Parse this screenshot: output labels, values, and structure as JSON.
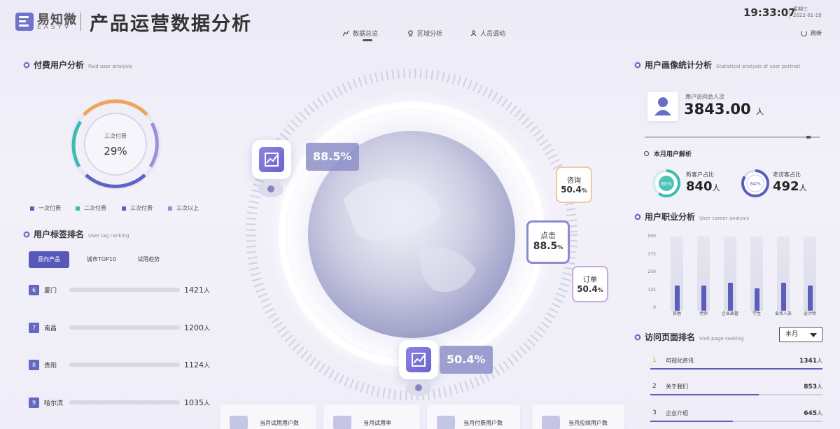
{
  "brand": {
    "cn": "易知微",
    "en": "EASYV"
  },
  "title": "产品运营数据分析",
  "time": {
    "clock": "19:33:07",
    "weekday": "星期三",
    "date": "2022-01-19"
  },
  "nav": [
    {
      "label": "数据总览",
      "icon": "chart-line-icon"
    },
    {
      "label": "区域分析",
      "icon": "location-icon"
    },
    {
      "label": "人员调动",
      "icon": "people-icon"
    }
  ],
  "refresh_label": "刷新",
  "paid_users": {
    "title": "付费用户分析",
    "subtitle": "Paid user analysis",
    "center_label": "三次付费",
    "center_value": "29%",
    "legend": [
      {
        "label": "一次付费",
        "color": "#5b5fba"
      },
      {
        "label": "二次付费",
        "color": "#44b8b0"
      },
      {
        "label": "三次付费",
        "color": "#5d63c9"
      },
      {
        "label": "三次以上",
        "color": "#9a8fdb"
      }
    ]
  },
  "tag_rank": {
    "title": "用户标签排名",
    "subtitle": "User tag ranking",
    "tabs": [
      "意向产品",
      "城市TOP10",
      "试用趋势"
    ],
    "rows": [
      {
        "num": "6",
        "city": "厦门",
        "value": "1421",
        "unit": "人",
        "ratio": 0.42
      },
      {
        "num": "7",
        "city": "南昌",
        "value": "1200",
        "unit": "人",
        "ratio": 0.35
      },
      {
        "num": "8",
        "city": "贵阳",
        "value": "1124",
        "unit": "人",
        "ratio": 0.33
      },
      {
        "num": "9",
        "city": "哈尔滨",
        "value": "1035",
        "unit": "人",
        "ratio": 0.3
      }
    ]
  },
  "center": {
    "pct_top": "88.5%",
    "pct_bottom": "50.4%",
    "bubbles": [
      {
        "label": "咨询",
        "value": "50.4",
        "unit": "%",
        "color": "#f0c8a0"
      },
      {
        "label": "点击",
        "value": "88.5",
        "unit": "%",
        "color": "#8a8cd0"
      },
      {
        "label": "订单",
        "value": "50.4",
        "unit": "%",
        "color": "#c8a8e0"
      }
    ],
    "bottom_cards": [
      "当月试用用户数",
      "当月试用率",
      "当月付费用户数",
      "当月应续用户数"
    ]
  },
  "portrait": {
    "title": "用户画像统计分析",
    "subtitle": "Statistical analysis of user portrait",
    "visit_label": "用户访问总人次",
    "visit_value": "3843.00",
    "visit_unit": "人",
    "month_title": "本月用户解析",
    "new": {
      "label": "新客户占比",
      "pct": "60%",
      "value": "840",
      "unit": "人",
      "color": "#3bbcb0"
    },
    "old": {
      "label": "老访客占比",
      "pct": "84%",
      "value": "492",
      "unit": "人",
      "color": "#5b5fba"
    }
  },
  "career": {
    "title": "用户职业分析",
    "subtitle": "User career analysis",
    "chart_data": {
      "type": "bar",
      "categories": [
        "其他",
        "老师",
        "企业高管",
        "学生",
        "业务人员",
        "设计师"
      ],
      "values": [
        175,
        175,
        195,
        155,
        195,
        175
      ],
      "yticks": [
        "500",
        "375",
        "250",
        "125",
        "0"
      ],
      "ylim": [
        0,
        500
      ]
    }
  },
  "visits": {
    "title": "访问页面排名",
    "subtitle": "Visit page ranking",
    "select": "本月",
    "rows": [
      {
        "idx": "1",
        "name": "可视化资讯",
        "value": "1341",
        "unit": "人",
        "ratio": 1.0
      },
      {
        "idx": "2",
        "name": "关于我们",
        "value": "853",
        "unit": "人",
        "ratio": 0.63
      },
      {
        "idx": "3",
        "name": "企业介绍",
        "value": "645",
        "unit": "人",
        "ratio": 0.48
      }
    ]
  }
}
